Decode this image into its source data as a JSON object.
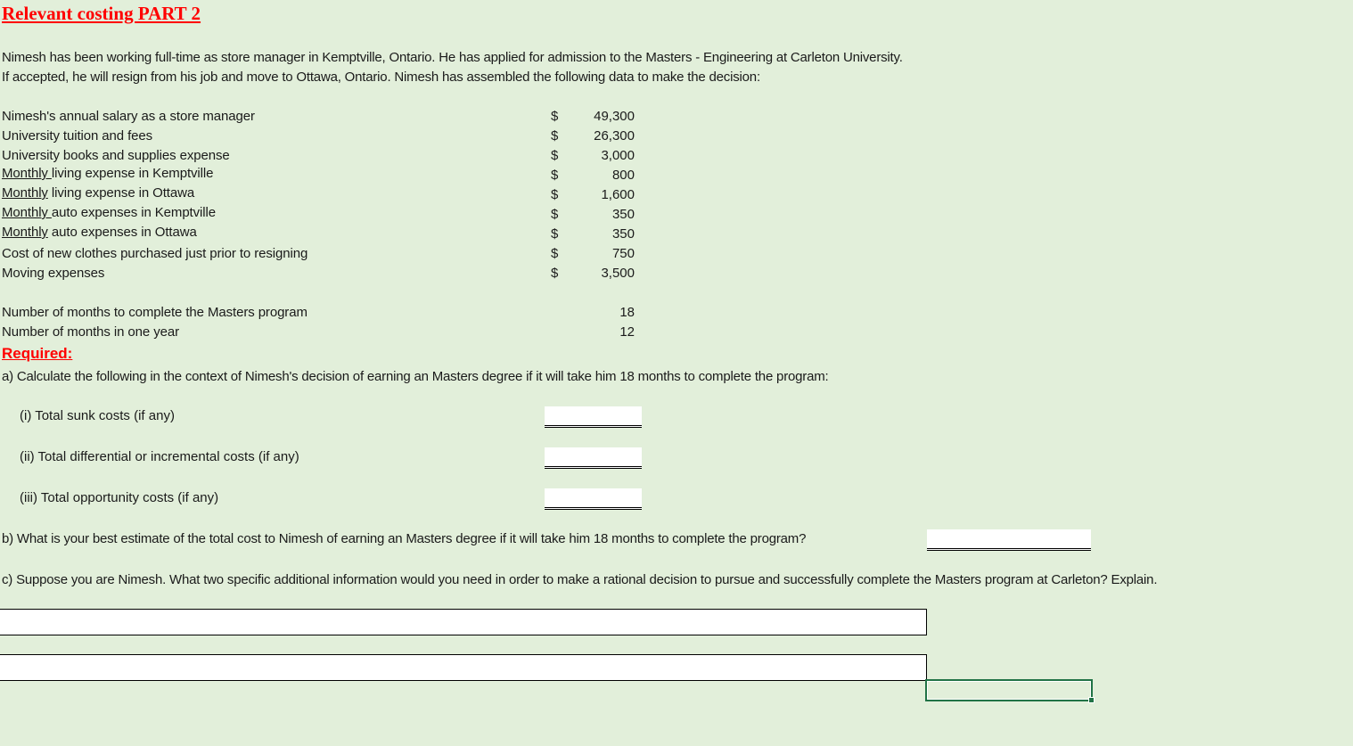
{
  "title": "Relevant costing PART 2",
  "intro": [
    "Nimesh has been working full-time as store manager in Kemptville, Ontario. He has applied for admission to the Masters - Engineering at Carleton University.",
    "If accepted, he will resign from his job and move to Ottawa, Ontario. Nimesh has assembled the following data to make the decision:"
  ],
  "data_items": [
    {
      "prefix": "",
      "label": "Nimesh's annual salary as a store manager",
      "currency": "$",
      "value": "49,300"
    },
    {
      "prefix": "",
      "label": "University tuition and fees",
      "currency": "$",
      "value": "26,300"
    },
    {
      "prefix": "",
      "label": "University books and supplies expense",
      "currency": "$",
      "value": "3,000"
    },
    {
      "prefix": "Monthly ",
      "label": "living expense in Kemptville",
      "currency": "$",
      "value": "800"
    },
    {
      "prefix": "Monthly",
      "label": " living expense in Ottawa",
      "currency": "$",
      "value": "1,600"
    },
    {
      "prefix": "Monthly ",
      "label": "auto expenses in Kemptville",
      "currency": "$",
      "value": "350"
    },
    {
      "prefix": "Monthly",
      "label": " auto expenses in Ottawa",
      "currency": "$",
      "value": "350"
    },
    {
      "prefix": "",
      "label": "Cost of new clothes purchased just prior to resigning",
      "currency": "$",
      "value": "750"
    },
    {
      "prefix": "",
      "label": "Moving expenses",
      "currency": "$",
      "value": "3,500"
    }
  ],
  "months_items": [
    {
      "label": "Number of months to complete the Masters program",
      "value": "18"
    },
    {
      "label": "Number of months in one year",
      "value": "12"
    }
  ],
  "required_label": "Required:",
  "question_a": "a) Calculate the following in the context of Nimesh's decision of earning an Masters degree if it will take him 18 months to complete the program:",
  "sub_questions": [
    {
      "label": "(i) Total sunk costs (if any)",
      "answer": ""
    },
    {
      "label": "(ii) Total differential or incremental costs (if any)",
      "answer": ""
    },
    {
      "label": "(iii) Total opportunity costs (if any)",
      "answer": ""
    }
  ],
  "question_b": {
    "label": "b) What is your best estimate of the total cost to Nimesh of earning an Masters degree if it will take him 18 months to complete the program?",
    "answer": ""
  },
  "question_c": {
    "label": "c) Suppose you are Nimesh. What two specific additional information would you need in order to make a rational decision to pursue and successfully complete the Masters program at Carleton? Explain.",
    "answers": [
      "",
      ""
    ]
  },
  "colors": {
    "background": "#e2efda",
    "heading_red": "#ff0000",
    "selection_green": "#217346"
  }
}
